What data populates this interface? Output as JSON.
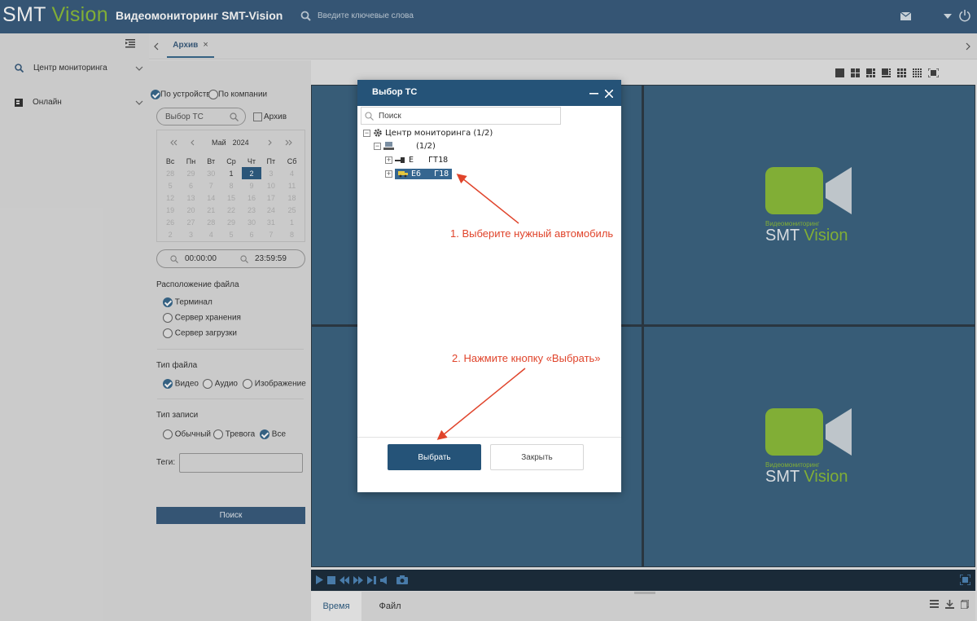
{
  "header": {
    "logo_smt": "SMT",
    "logo_vision": "Vision",
    "app_title": "Видеомониторинг SMT-Vision",
    "search_placeholder": "Введите ключевые слова"
  },
  "sidebar": {
    "items": [
      {
        "label": "Центр мониторинга",
        "icon": "zoom-icon"
      },
      {
        "label": "Онлайн",
        "icon": "online-icon"
      }
    ]
  },
  "tabs": [
    {
      "label": "Архив",
      "close": "×"
    }
  ],
  "filter": {
    "by_device": "По устройству",
    "by_company": "По компании",
    "select_vehicle_placeholder": "Выбор ТС",
    "archive_label": "Архив",
    "calendar": {
      "month": "Май",
      "year": "2024",
      "weekdays": [
        "Вс",
        "Пн",
        "Вт",
        "Ср",
        "Чт",
        "Пт",
        "Сб"
      ],
      "weeks": [
        [
          "28",
          "29",
          "30",
          "1",
          "2",
          "3",
          "4"
        ],
        [
          "5",
          "6",
          "7",
          "8",
          "9",
          "10",
          "11"
        ],
        [
          "12",
          "13",
          "14",
          "15",
          "16",
          "17",
          "18"
        ],
        [
          "19",
          "20",
          "21",
          "22",
          "23",
          "24",
          "25"
        ],
        [
          "26",
          "27",
          "28",
          "29",
          "30",
          "31",
          "1"
        ],
        [
          "2",
          "3",
          "4",
          "5",
          "6",
          "7",
          "8"
        ]
      ],
      "current_days": [
        "1",
        "2"
      ],
      "selected_day": "2"
    },
    "time_from": "00:00:00",
    "time_to": "23:59:59",
    "file_location_label": "Расположение файла",
    "file_location_options": [
      "Терминал",
      "Сервер хранения",
      "Сервер загрузки"
    ],
    "file_type_label": "Тип файла",
    "file_type_options": [
      "Видео",
      "Аудио",
      "Изображение"
    ],
    "record_type_label": "Тип записи",
    "record_type_options": [
      "Обычный",
      "Тревога",
      "Все"
    ],
    "tags_label": "Теги:",
    "search_button": "Поиск"
  },
  "watermark": {
    "caption": "Видеомониторинг",
    "smt": "SMT",
    "vision": "Vision"
  },
  "bottom_tabs": [
    "Время",
    "Файл"
  ],
  "dialog": {
    "title": "Выбор ТС",
    "search_placeholder": "Поиск",
    "tree": {
      "root": "Центр мониторинга (1/2)",
      "group": "(1/2)",
      "vehicle_1_prefix": "Е",
      "vehicle_1_suffix": "ГТ18",
      "vehicle_2_prefix": "Е6",
      "vehicle_2_suffix": "Г18"
    },
    "select_button": "Выбрать",
    "close_button": "Закрыть"
  },
  "annotations": {
    "step1": "1. Выберите нужный автомобиль",
    "step2": "2. Нажмите кнопку «Выбрать»"
  },
  "colors": {
    "header_bg": "#3a5d7e",
    "accent_green": "#8cbd3b",
    "video_cell_bg": "#3c6482",
    "dialog_header": "#255378",
    "annotation_red": "#e0442b"
  }
}
